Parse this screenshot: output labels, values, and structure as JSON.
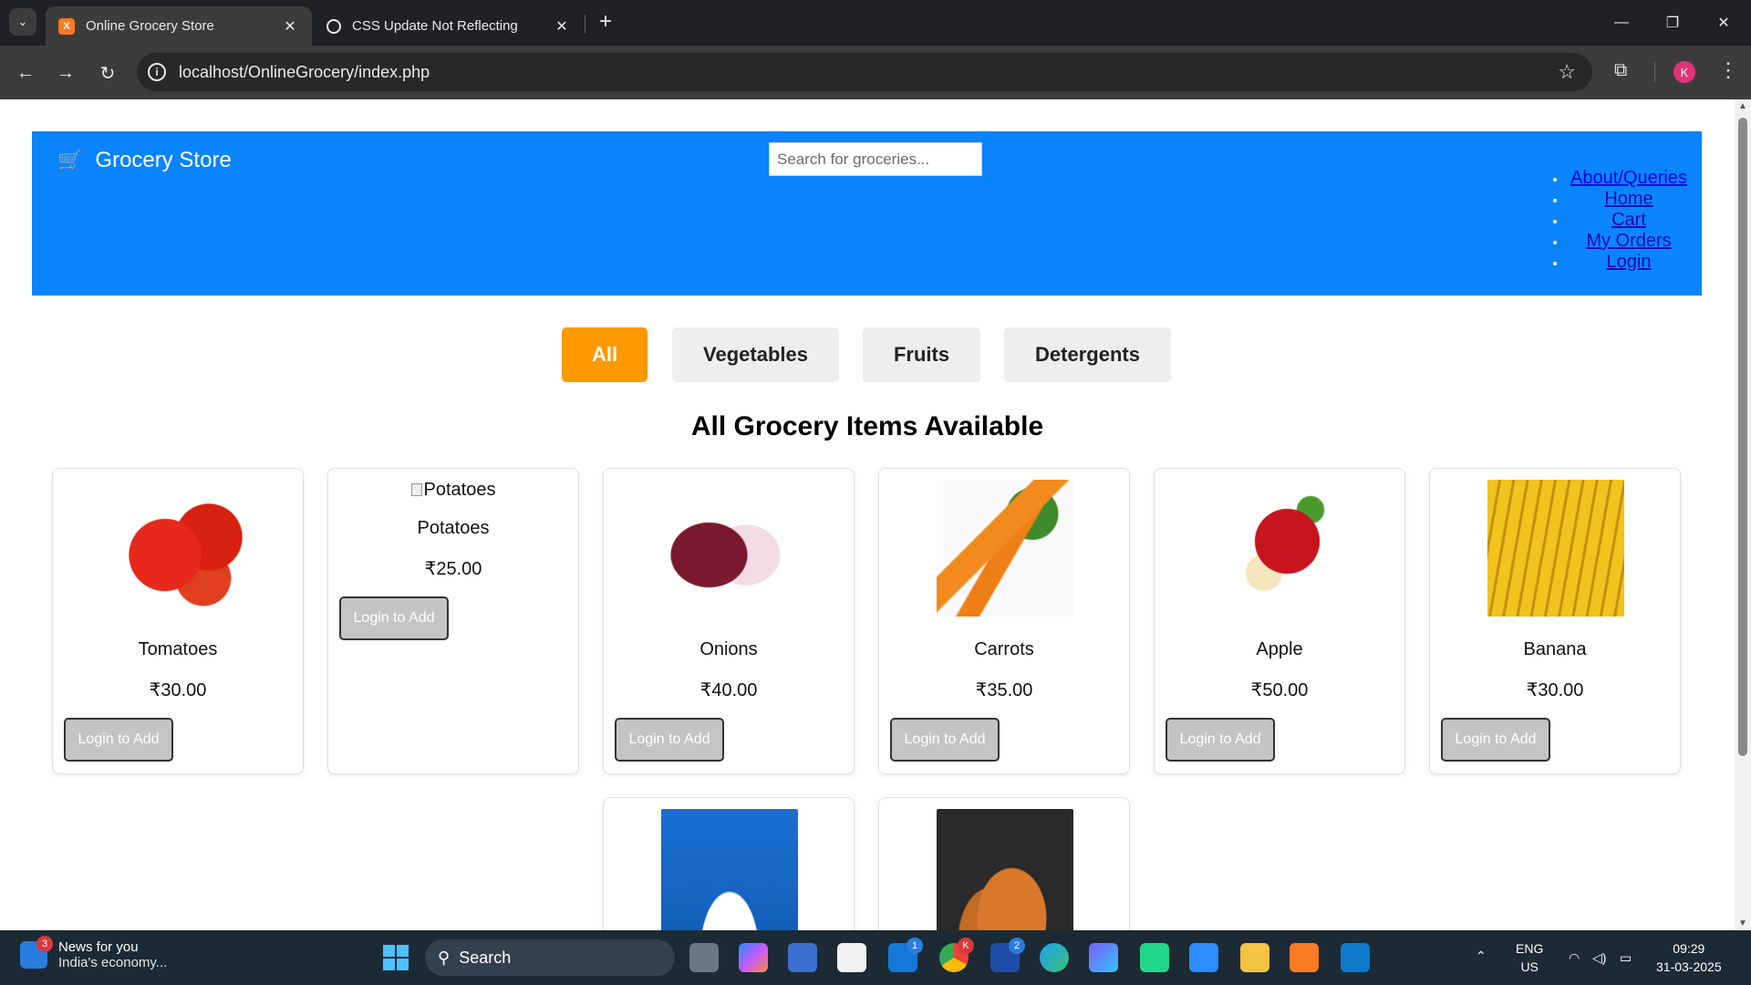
{
  "browser": {
    "tabs": [
      {
        "title": "Online Grocery Store",
        "active": true
      },
      {
        "title": "CSS Update Not Reflecting",
        "active": false
      }
    ],
    "url": "localhost/OnlineGrocery/index.php"
  },
  "header": {
    "brand": "Grocery Store",
    "search_placeholder": "Search for groceries...",
    "nav": [
      "About/Queries",
      "Home",
      "Cart",
      "My Orders",
      "Login"
    ]
  },
  "filters": [
    "All",
    "Vegetables",
    "Fruits",
    "Detergents"
  ],
  "active_filter": "All",
  "section_title": "All Grocery Items Available",
  "products": [
    {
      "name": "Tomatoes",
      "price": "₹30.00",
      "button": "Login to Add",
      "image": "tomato-image"
    },
    {
      "name": "Potatoes",
      "price": "₹25.00",
      "button": "Login to Add",
      "image_alt": "Potatoes"
    },
    {
      "name": "Onions",
      "price": "₹40.00",
      "button": "Login to Add",
      "image": "onion-image"
    },
    {
      "name": "Carrots",
      "price": "₹35.00",
      "button": "Login to Add",
      "image": "carrot-image"
    },
    {
      "name": "Apple",
      "price": "₹50.00",
      "button": "Login to Add",
      "image": "apple-image"
    },
    {
      "name": "Banana",
      "price": "₹30.00",
      "button": "Login to Add",
      "image": "banana-image"
    }
  ],
  "products_row2": [
    {
      "image": "milk-image"
    },
    {
      "image": "bread-image"
    }
  ],
  "taskbar": {
    "news_title": "News for you",
    "news_subtitle": "India's economy...",
    "news_badge": "3",
    "search_label": "Search",
    "mail_badge": "1",
    "chrome_badge": "K",
    "app_badge": "2",
    "lang1": "ENG",
    "lang2": "US",
    "time": "09:29",
    "date": "31-03-2025"
  },
  "colors": {
    "header_bg": "#0a84ff",
    "active_filter": "#ff9900",
    "filter_bg": "#eeeeee"
  }
}
